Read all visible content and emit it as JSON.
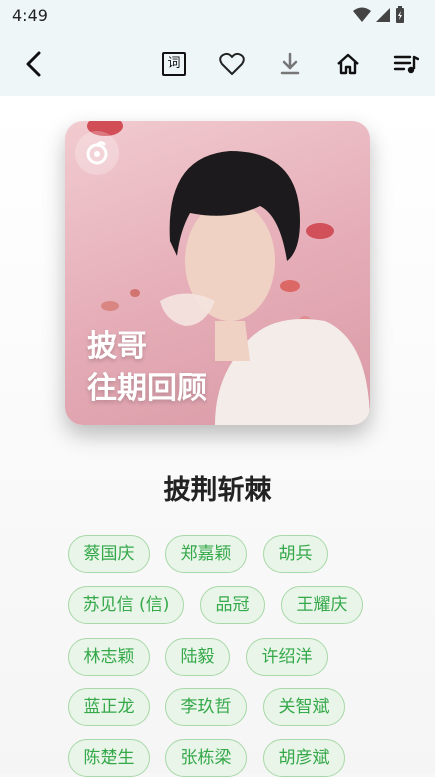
{
  "status": {
    "time": "4:49"
  },
  "toolbar": {
    "back_icon": "chevron-left-icon",
    "lyrics_icon": "lyrics-icon",
    "lyrics_glyph": "词",
    "favorite_icon": "heart-icon",
    "download_icon": "download-icon",
    "home_icon": "home-icon",
    "playlist_icon": "playlist-icon"
  },
  "cover": {
    "line1": "披哥",
    "line2": "往期回顾"
  },
  "title": "披荆斩棘",
  "tags": [
    "蔡国庆",
    "郑嘉颖",
    "胡兵",
    "苏见信 (信)",
    "品冠",
    "王耀庆",
    "林志颖",
    "陆毅",
    "许绍洋",
    "蓝正龙",
    "李玖哲",
    "关智斌",
    "陈楚生",
    "张栋梁",
    "胡彦斌"
  ],
  "colors": {
    "accent": "#35a84a",
    "chip_bg": "#e8f5e8",
    "chip_border": "#a8d8a8"
  }
}
